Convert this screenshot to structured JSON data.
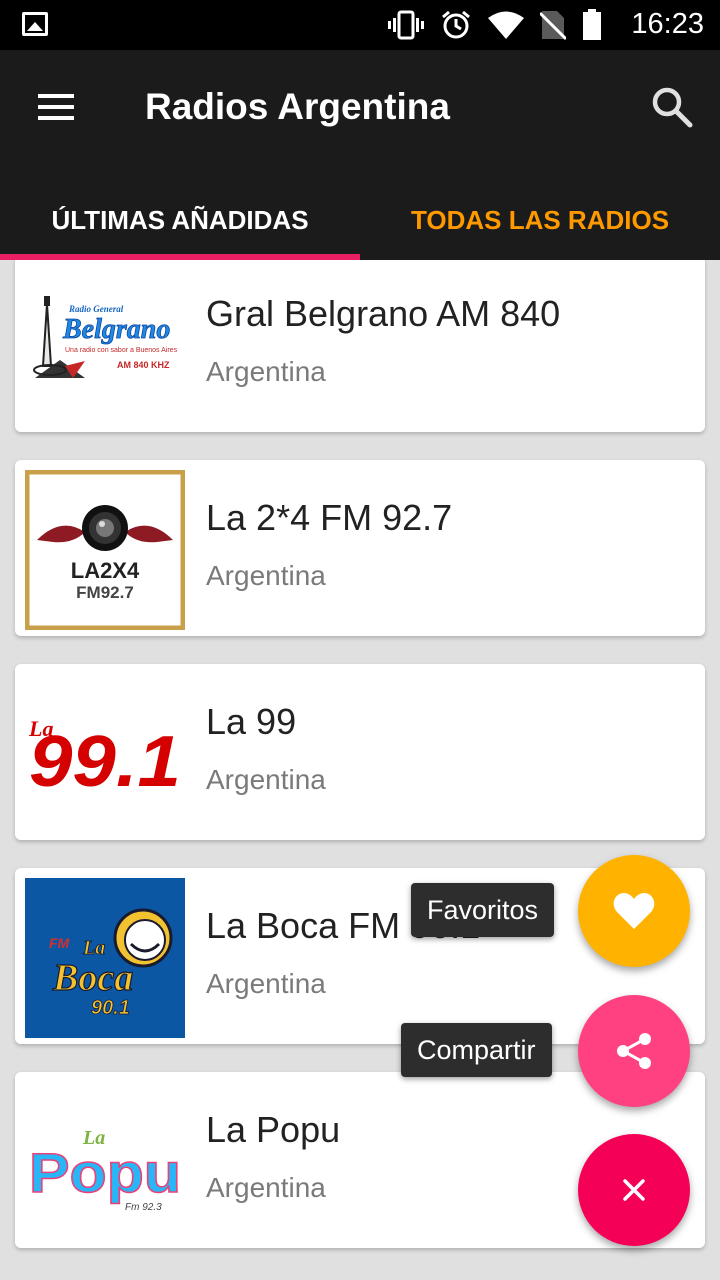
{
  "status_bar": {
    "time": "16:23",
    "icons": [
      "gallery-icon",
      "vibrate-icon",
      "alarm-icon",
      "wifi-icon",
      "no-sim-icon",
      "battery-icon"
    ]
  },
  "app_bar": {
    "title": "Radios Argentina",
    "menu_icon": "menu-icon",
    "search_icon": "search-icon"
  },
  "tabs": [
    {
      "label": "ÚLTIMAS AÑADIDAS",
      "selected": true
    },
    {
      "label": "TODAS LAS RADIOS",
      "selected": false
    }
  ],
  "stations": [
    {
      "name": "Gral Belgrano AM 840",
      "country": "Argentina",
      "logo": {
        "line1": "Radio General",
        "line2": "Belgrano",
        "line3": "Una radio con sabor a Buenos Aires",
        "line4": "AM 840 KHZ"
      }
    },
    {
      "name": "La 2*4 FM 92.7",
      "country": "Argentina",
      "logo": {
        "line1": "LA2X4",
        "line2": "FM92.7"
      }
    },
    {
      "name": "La 99",
      "country": "Argentina",
      "logo": {
        "line1": "La",
        "line2": "99.1"
      }
    },
    {
      "name": "La Boca FM 90.1",
      "country": "Argentina",
      "logo": {
        "line1": "FM",
        "line2": "La",
        "line3": "Boca",
        "line4": "90.1"
      }
    },
    {
      "name": "La Popu",
      "country": "Argentina",
      "logo": {
        "line1": "La",
        "line2": "Popu",
        "line3": "Fm 92.3"
      }
    }
  ],
  "fab_menu": {
    "favorites": {
      "label": "Favoritos",
      "icon": "heart-icon",
      "color": "#FFB300"
    },
    "share": {
      "label": "Compartir",
      "icon": "share-icon",
      "color": "#FF4081"
    },
    "close": {
      "icon": "close-icon",
      "color": "#F50057"
    }
  },
  "colors": {
    "app_bar": "#1B1B1B",
    "tab_active_text": "#FFFFFF",
    "tab_inactive_text": "#FF9900",
    "tab_indicator": "#E91E63",
    "list_background": "#E0E0E0"
  }
}
